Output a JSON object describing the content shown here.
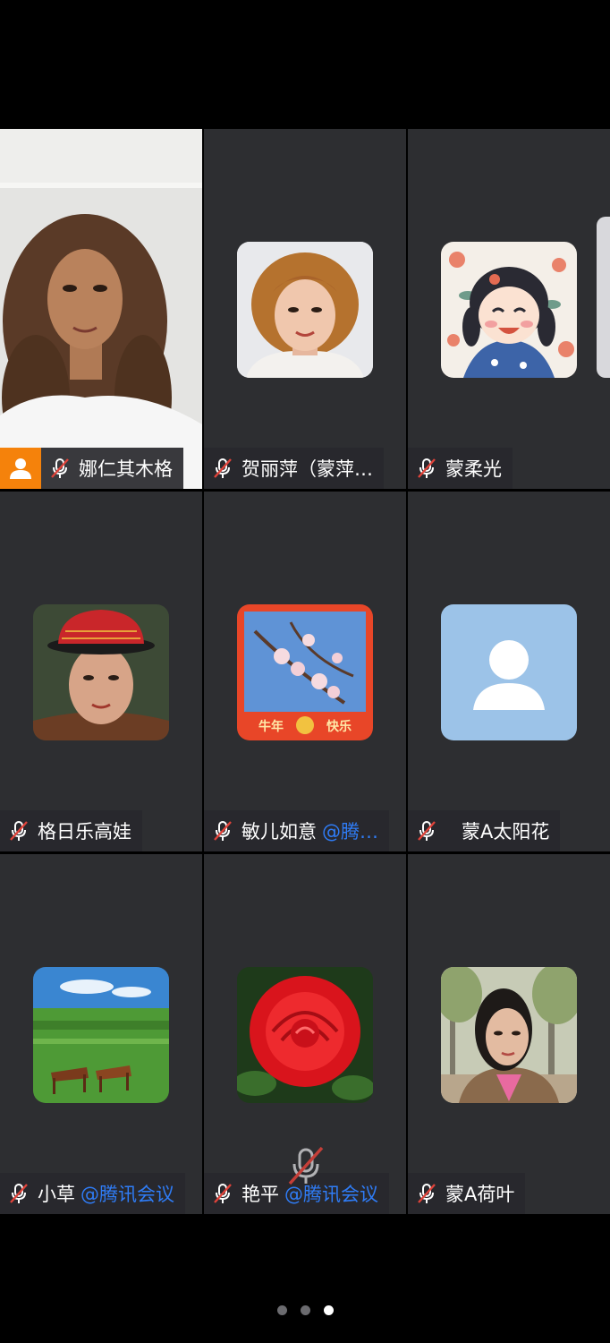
{
  "participants": [
    {
      "name": "娜仁其木格",
      "suffix": "",
      "is_host": true,
      "muted": true,
      "avatar": "woman-curly-hair-video"
    },
    {
      "name": "贺丽萍（蒙萍…",
      "suffix": "",
      "is_host": false,
      "muted": true,
      "avatar": "woman-short-curly-photo"
    },
    {
      "name": "蒙柔光",
      "suffix": "",
      "is_host": false,
      "muted": true,
      "avatar": "cartoon-girl-illustration"
    },
    {
      "name": "格日乐高娃",
      "suffix": "",
      "is_host": false,
      "muted": true,
      "avatar": "woman-mongolian-hat-photo"
    },
    {
      "name": "敏儿如意",
      "suffix": "@腾…",
      "is_host": false,
      "muted": true,
      "avatar": "peach-blossom-new-year-card"
    },
    {
      "name": "蒙A太阳花",
      "suffix": "",
      "is_host": false,
      "muted": true,
      "avatar": "default-person-avatar"
    },
    {
      "name": "小草",
      "suffix": "@腾讯会议",
      "is_host": false,
      "muted": true,
      "avatar": "grassland-horses-photo"
    },
    {
      "name": "艳平",
      "suffix": "@腾讯会议",
      "is_host": false,
      "muted": true,
      "avatar": "red-rose-photo"
    },
    {
      "name": "蒙A荷叶",
      "suffix": "",
      "is_host": false,
      "muted": true,
      "avatar": "woman-outdoor-trees-photo"
    }
  ],
  "card_text": {
    "left": "牛年",
    "right": "快乐"
  },
  "pager": {
    "total": 3,
    "active": 3
  },
  "colors": {
    "tile_bg": "#2d2e31",
    "host_badge": "#f5820b",
    "link_blue": "#2f7cf6",
    "default_avatar_bg": "#9cc3e8"
  }
}
